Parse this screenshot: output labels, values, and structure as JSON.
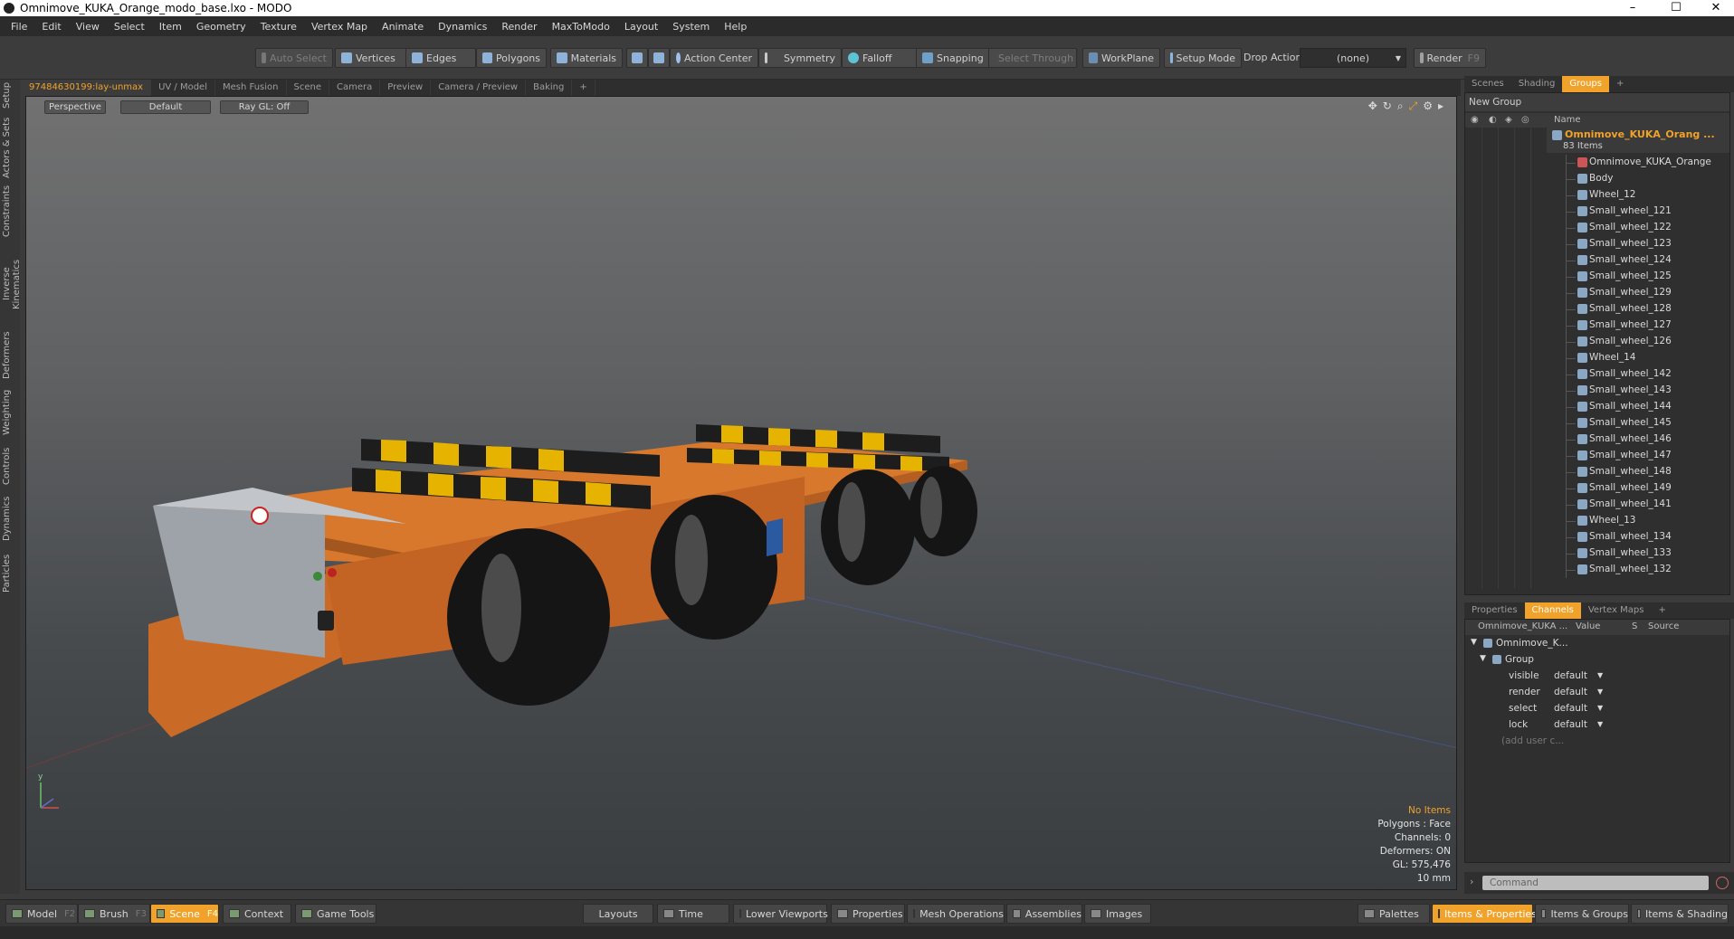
{
  "window": {
    "title": "Omnimove_KUKA_Orange_modo_base.lxo - MODO"
  },
  "menu": [
    "File",
    "Edit",
    "View",
    "Select",
    "Item",
    "Geometry",
    "Texture",
    "Vertex Map",
    "Animate",
    "Dynamics",
    "Render",
    "MaxToModo",
    "Layout",
    "System",
    "Help"
  ],
  "toolbar": {
    "auto_select": "Auto Select",
    "vertices": "Vertices",
    "edges": "Edges",
    "polygons": "Polygons",
    "materials": "Materials",
    "action_center": "Action Center",
    "symmetry": "Symmetry",
    "falloff": "Falloff",
    "snapping": "Snapping",
    "select_through": "Select Through",
    "workplane": "WorkPlane",
    "setup_mode": "Setup Mode",
    "drop_action": "Drop Action",
    "drop_value": "(none)",
    "render": "Render",
    "render_key": "F9"
  },
  "left_tabs": [
    "Setup",
    "Actors & Sets",
    "Constraints",
    "Inverse Kinematics",
    "Deformers",
    "Weighting",
    "Controls",
    "Dynamics",
    "Particles"
  ],
  "viewport_tabs": [
    "97484630199:lay-unmax",
    "UV / Model",
    "Mesh Fusion",
    "Scene",
    "Camera",
    "Preview",
    "Camera / Preview",
    "Baking"
  ],
  "viewport": {
    "view": "Perspective",
    "shading": "Default",
    "raygl": "Ray GL: Off",
    "info": {
      "items": "No Items",
      "polygons": "Polygons : Face",
      "channels": "Channels: 0",
      "deformers": "Deformers: ON",
      "gl": "GL: 575,476",
      "scale": "10 mm"
    }
  },
  "right_top_tabs": [
    "Scenes",
    "Shading",
    "Groups"
  ],
  "groups": {
    "new_group": "New Group",
    "name_header": "Name",
    "root_name": "Omnimove_KUKA_Orang ...",
    "root_count": "83 Items",
    "items": [
      "Omnimove_KUKA_Orange",
      "Body",
      "Wheel_12",
      "Small_wheel_121",
      "Small_wheel_122",
      "Small_wheel_123",
      "Small_wheel_124",
      "Small_wheel_125",
      "Small_wheel_129",
      "Small_wheel_128",
      "Small_wheel_127",
      "Small_wheel_126",
      "Wheel_14",
      "Small_wheel_142",
      "Small_wheel_143",
      "Small_wheel_144",
      "Small_wheel_145",
      "Small_wheel_146",
      "Small_wheel_147",
      "Small_wheel_148",
      "Small_wheel_149",
      "Small_wheel_141",
      "Wheel_13",
      "Small_wheel_134",
      "Small_wheel_133",
      "Small_wheel_132"
    ]
  },
  "right_bottom_tabs": [
    "Properties",
    "Channels",
    "Vertex Maps"
  ],
  "channels": {
    "header": {
      "name": "Omnimove_KUKA ...",
      "value": "Value",
      "s": "S",
      "source": "Source"
    },
    "root": "Omnimove_K...",
    "group": "Group",
    "rows": [
      {
        "name": "visible",
        "value": "default"
      },
      {
        "name": "render",
        "value": "default"
      },
      {
        "name": "select",
        "value": "default"
      },
      {
        "name": "lock",
        "value": "default"
      }
    ],
    "add_user": "(add user c..."
  },
  "command": {
    "placeholder": "Command"
  },
  "bottom": {
    "model": "Model",
    "model_key": "F2",
    "brush": "Brush",
    "brush_key": "F3",
    "scene": "Scene",
    "scene_key": "F4",
    "context": "Context",
    "game_tools": "Game Tools",
    "layouts": "Layouts",
    "time": "Time",
    "lower_viewports": "Lower Viewports",
    "properties": "Properties",
    "mesh_operations": "Mesh Operations",
    "assemblies": "Assemblies",
    "images": "Images",
    "palettes": "Palettes",
    "items_properties": "Items & Properties",
    "items_groups": "Items & Groups",
    "items_shading": "Items & Shading"
  },
  "colors": {
    "accent": "#f0a22a",
    "robot_body": "#d8782c",
    "stripe_yellow": "#e6b400"
  }
}
